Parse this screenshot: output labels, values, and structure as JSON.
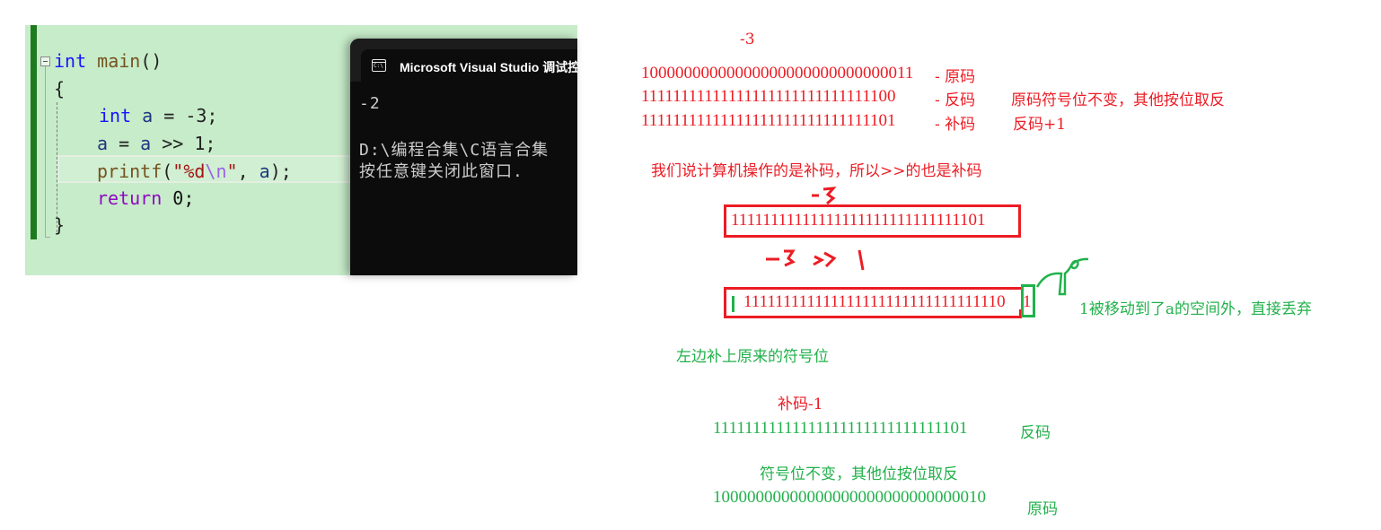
{
  "editor": {
    "lines": [
      {
        "tokens": [
          {
            "t": "int",
            "c": "kw"
          },
          {
            "t": " ",
            "c": "op"
          },
          {
            "t": "main",
            "c": "fn"
          },
          {
            "t": "()",
            "c": "op"
          }
        ]
      },
      {
        "tokens": [
          {
            "t": "{",
            "c": "op"
          }
        ]
      },
      {
        "tokens": [
          {
            "t": "int",
            "c": "kw"
          },
          {
            "t": " ",
            "c": "op"
          },
          {
            "t": "a",
            "c": "var"
          },
          {
            "t": " = -3;",
            "c": "op"
          }
        ]
      },
      {
        "tokens": [
          {
            "t": "a",
            "c": "var"
          },
          {
            "t": " = ",
            "c": "op"
          },
          {
            "t": "a",
            "c": "var"
          },
          {
            "t": " >> 1;",
            "c": "op"
          }
        ]
      },
      {
        "tokens": [
          {
            "t": "printf",
            "c": "fn"
          },
          {
            "t": "(",
            "c": "op"
          },
          {
            "t": "\"%d",
            "c": "str"
          },
          {
            "t": "\\n",
            "c": "esc"
          },
          {
            "t": "\"",
            "c": "str"
          },
          {
            "t": ", ",
            "c": "op"
          },
          {
            "t": "a",
            "c": "var"
          },
          {
            "t": ");",
            "c": "op"
          }
        ]
      },
      {
        "tokens": [
          {
            "t": "return",
            "c": "ret"
          },
          {
            "t": " 0;",
            "c": "num"
          }
        ]
      },
      {
        "tokens": [
          {
            "t": "}",
            "c": "op"
          }
        ]
      }
    ]
  },
  "console": {
    "title": "Microsoft Visual Studio 调试控制台",
    "icon": "cmd-icon",
    "icon_text": "C:\\",
    "output": [
      "-2",
      "",
      "D:\\编程合集\\C语言合集",
      "按任意键关闭此窗口."
    ]
  },
  "notes": {
    "neg3_label": "-3",
    "original_code": "10000000000000000000000000000011",
    "original_label": "- 原码",
    "ones_complement": "11111111111111111111111111111100",
    "ones_label": "- 反码",
    "ones_rule": "原码符号位不变，其他按位取反",
    "twos_complement": "11111111111111111111111111111101",
    "twos_label": "- 补码",
    "twos_rule": "反码+1",
    "statement": "我们说计算机操作的是补码，所以>>的也是补码",
    "hand_neg3": "-3",
    "boxed_before": "11111111111111111111111111111101",
    "hand_shift_expr": "-3 >> 1",
    "boxed_after": "1111111111111111111111111111111101",
    "boxed_after_main": "111111111111111111111111111111110",
    "boxed_after_dropped": "1",
    "dropped_note": "1被移动到了a的空间外，直接丢弃",
    "sign_fill_note": "左边补上原来的符号位",
    "minus_one_label": "补码-1",
    "result_ones": "11111111111111111111111111111101",
    "result_ones_label": "反码",
    "invert_rule": "符号位不变，其他位按位取反",
    "result_original": "10000000000000000000000000000010",
    "result_original_label": "原码"
  },
  "colors": {
    "editor_bg": "#c7ecc9",
    "console_bg": "#0c0c0c",
    "annotation_red": "#ec1c24",
    "annotation_green": "#22b14c"
  }
}
